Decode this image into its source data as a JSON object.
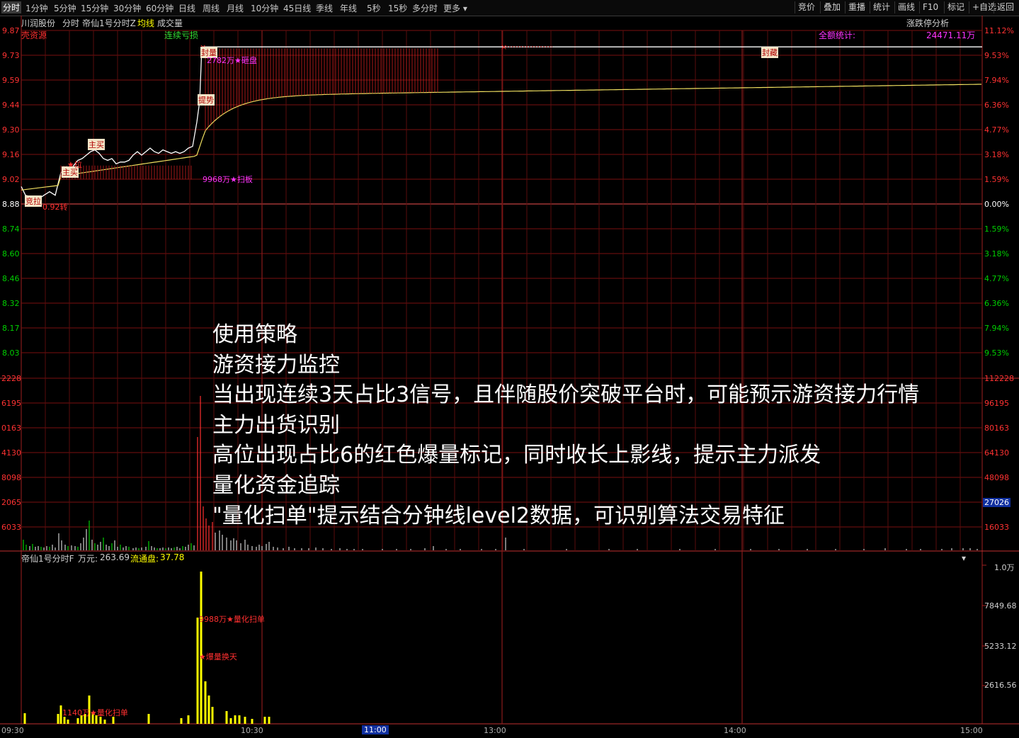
{
  "toolbar": {
    "tabs": [
      "分时",
      "1分钟",
      "5分钟",
      "15分钟",
      "30分钟",
      "60分钟",
      "日线",
      "周线",
      "月线",
      "10分钟",
      "45日线",
      "季线",
      "年线",
      "5秒",
      "15秒",
      "多分时",
      "更多"
    ],
    "active_tab": "分时",
    "right_buttons": [
      "竞价",
      "叠加",
      "重播",
      "统计",
      "画线",
      "F10",
      "标记",
      "+自选",
      "返回"
    ]
  },
  "header": {
    "stock_name": "川润股份",
    "view_label": "分时",
    "indicator_name": "帝仙1号分时Z",
    "avg_line_label": "均线",
    "volume_label": "成交量",
    "limit_analysis": "涨跌停分析",
    "loss_label": "连续亏损",
    "total_stat_label": "全额统计:",
    "total_stat_value": "24471.11万",
    "source_label": "壳资源"
  },
  "price_axis": {
    "left": [
      "9.87",
      "9.73",
      "9.59",
      "9.44",
      "9.30",
      "9.16",
      "9.02",
      "8.88",
      "8.74",
      "8.60",
      "8.46",
      "8.32",
      "8.17",
      "8.03"
    ],
    "right": [
      "11.12%",
      "9.53%",
      "7.94%",
      "6.36%",
      "4.77%",
      "3.18%",
      "1.59%",
      "0.00%",
      "1.59%",
      "3.18%",
      "4.77%",
      "6.36%",
      "7.94%",
      "9.53%"
    ],
    "colors": {
      "up": "#ff3232",
      "flat": "#ffffff",
      "down": "#00d000"
    }
  },
  "volume_axis": {
    "left": [
      "2228",
      "6195",
      "0163",
      "4130",
      "8098",
      "2065",
      "6033"
    ],
    "right": [
      "112228",
      "96195",
      "80163",
      "64130",
      "48098",
      "27026",
      "16033"
    ],
    "highlight": "27026"
  },
  "sub_panel": {
    "indicator_name": "帝仙1号分时F",
    "unit_label": "万元:",
    "unit_value": "263.69",
    "float_label": "流通盘:",
    "float_value": "37.78",
    "axis": [
      "1.0万",
      "7849.68",
      "5233.12",
      "2616.56"
    ]
  },
  "annotations": {
    "auction": "竞拉",
    "chip_turn": "0.92转",
    "main_buy_1": "主买",
    "main_buy_2": "主买",
    "pull_up": "拉",
    "lift": "提势",
    "seal_volume": "封量",
    "amount_dump": "2782万★砸盘",
    "amount_sweep": "9968万★扫板",
    "seal_tag": "封藏",
    "quant_scan_big": "9988万★量化扫单",
    "burst_volume": "★爆量换天",
    "quant_scan_small": "1140万★量化扫单"
  },
  "time_axis": [
    "09:30",
    "10:30",
    "11:00",
    "13:00",
    "14:00",
    "15:00"
  ],
  "overlay_text": [
    "使用策略",
    "游资接力监控",
    "当出现连续3天占比3信号，且伴随股价突破平台时，可能预示游资接力行情",
    "主力出货识别",
    "高位出现占比6的红色爆量标记，同时收长上影线，提示主力派发",
    "量化资金追踪",
    "\"量化扫单\"提示结合分钟线level2数据，可识别算法交易特征"
  ]
}
